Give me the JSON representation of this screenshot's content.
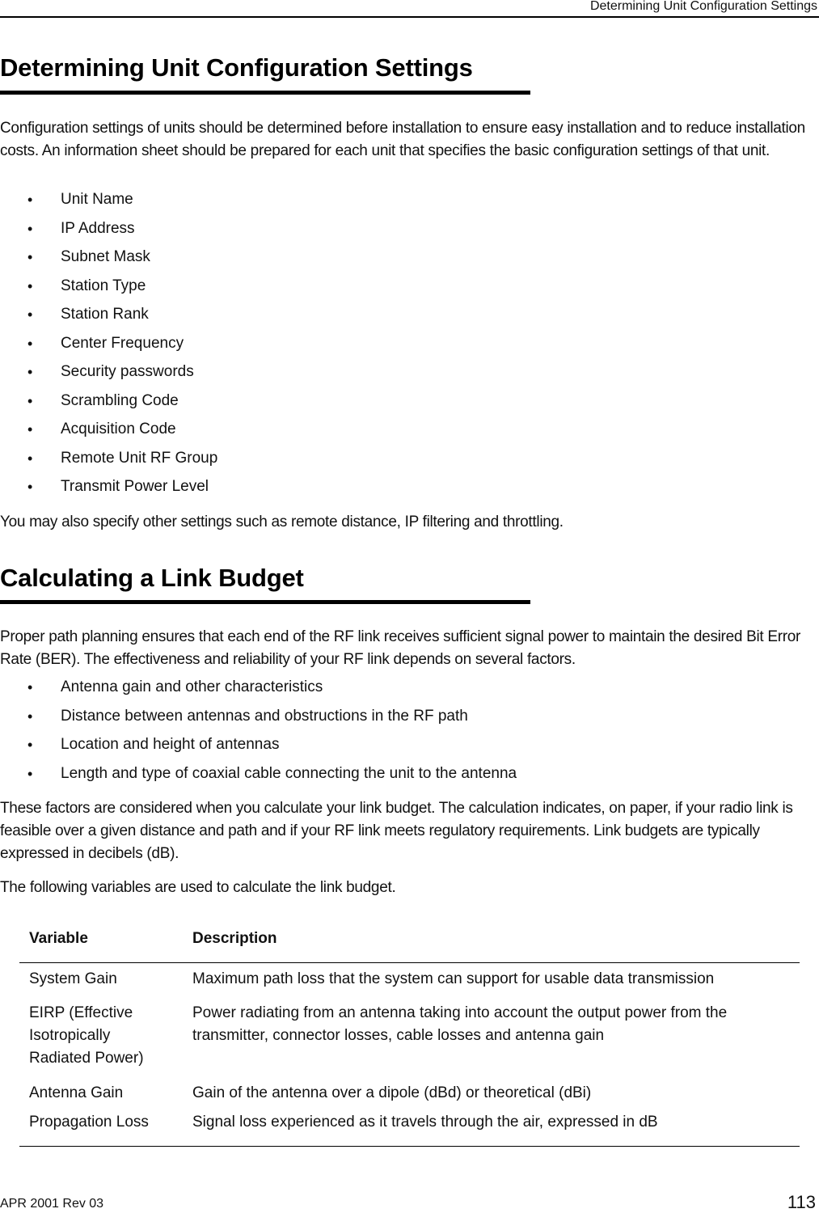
{
  "running_header": "Determining Unit Configuration Settings",
  "section1": {
    "title": "Determining Unit Configuration Settings",
    "intro": "Configuration settings of units should be determined before installation to ensure easy installation and to reduce installation costs. An information sheet should be prepared for each unit that specifies the basic configuration settings of that unit.",
    "items": [
      "Unit Name",
      "IP Address",
      "Subnet Mask",
      "Station Type",
      "Station Rank",
      "Center Frequency",
      "Security passwords",
      "Scrambling Code",
      "Acquisition Code",
      "Remote Unit RF Group",
      "Transmit Power Level"
    ],
    "outro": "You may also specify other settings such as remote distance, IP filtering and throttling."
  },
  "section2": {
    "title": "Calculating a Link Budget",
    "intro": "Proper path planning ensures that each end of the RF link receives sufficient signal power to maintain the desired Bit Error Rate (BER). The effectiveness and reliability of your RF link depends on several factors.",
    "items": [
      "Antenna gain and other characteristics",
      "Distance between antennas and obstructions in the RF path",
      "Location and height of antennas",
      "Length and type of coaxial cable connecting the unit to the antenna"
    ],
    "para2": "These factors are considered when you calculate your link budget. The calculation indicates, on paper, if your radio link is feasible over a given distance and path and if your RF link meets regulatory requirements. Link budgets are typically expressed in decibels (dB).",
    "para3": "The following variables are used to calculate the link budget."
  },
  "table": {
    "headers": [
      "Variable",
      "Description"
    ],
    "rows": [
      {
        "variable": "System Gain",
        "description": "Maximum path loss that the system can support for usable data transmission"
      },
      {
        "variable": "EIRP (Effective Isotropically Radiated Power)",
        "description": "Power radiating from an antenna taking into account the output power from the transmitter, connector losses, cable losses and antenna gain"
      },
      {
        "variable": "Antenna Gain",
        "description": "Gain of the antenna over a dipole (dBd) or theoretical (dBi)"
      },
      {
        "variable": "Propagation Loss",
        "description": "Signal loss experienced as it travels through the air, expressed in dB"
      }
    ]
  },
  "footer": {
    "revision": "APR 2001 Rev 03",
    "page_number": "113"
  }
}
